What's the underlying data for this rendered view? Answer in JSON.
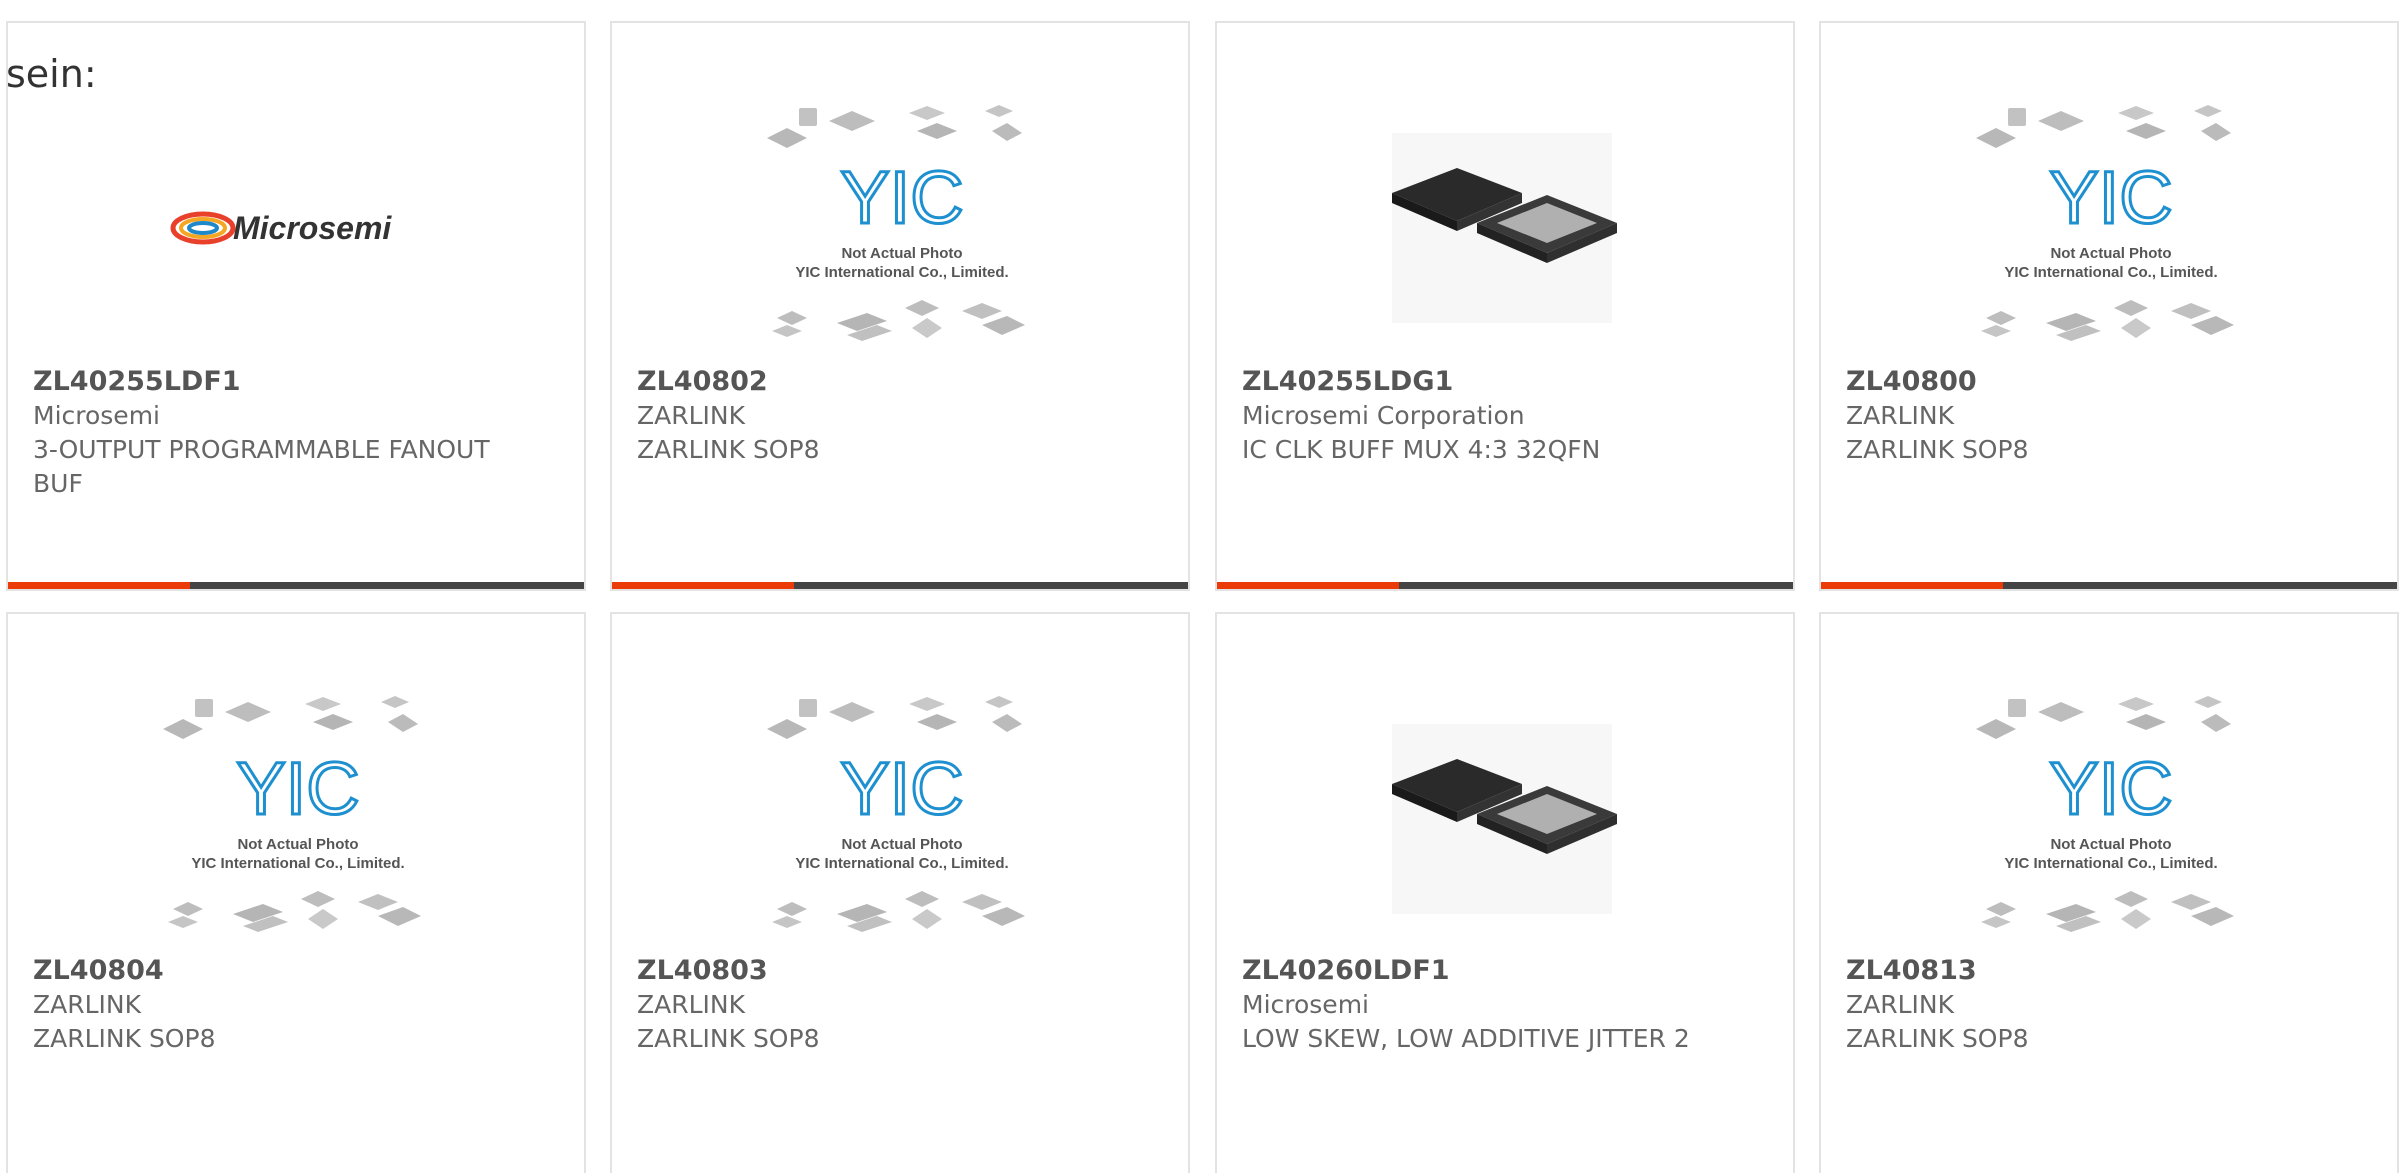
{
  "intro_text": "sein:",
  "colors": {
    "accent": "#ea3b08",
    "bar": "#444444",
    "border": "#e3e3e3",
    "text": "#666666"
  },
  "placeholder": {
    "logo_text": "YIC",
    "line1": "Not Actual Photo",
    "line2": "YIC International Co., Limited."
  },
  "brand_logo": {
    "text": "Microsemi"
  },
  "products": [
    {
      "part": "ZL40255LDF1",
      "manufacturer": "Microsemi",
      "description": "3-OUTPUT PROGRAMMABLE FANOUT BUF",
      "image": "microsemi-logo"
    },
    {
      "part": "ZL40802",
      "manufacturer": "ZARLINK",
      "description": "ZARLINK SOP8",
      "image": "not-actual-photo"
    },
    {
      "part": "ZL40255LDG1",
      "manufacturer": "Microsemi Corporation",
      "description": "IC CLK BUFF MUX 4:3 32QFN",
      "image": "qfn-chip-photo"
    },
    {
      "part": "ZL40800",
      "manufacturer": "ZARLINK",
      "description": "ZARLINK SOP8",
      "image": "not-actual-photo"
    },
    {
      "part": "ZL40804",
      "manufacturer": "ZARLINK",
      "description": "ZARLINK SOP8",
      "image": "not-actual-photo"
    },
    {
      "part": "ZL40803",
      "manufacturer": "ZARLINK",
      "description": "ZARLINK SOP8",
      "image": "not-actual-photo"
    },
    {
      "part": "ZL40260LDF1",
      "manufacturer": "Microsemi",
      "description": "LOW SKEW, LOW ADDITIVE JITTER 2",
      "image": "qfn-chip-photo"
    },
    {
      "part": "ZL40813",
      "manufacturer": "ZARLINK",
      "description": "ZARLINK SOP8",
      "image": "not-actual-photo"
    }
  ]
}
